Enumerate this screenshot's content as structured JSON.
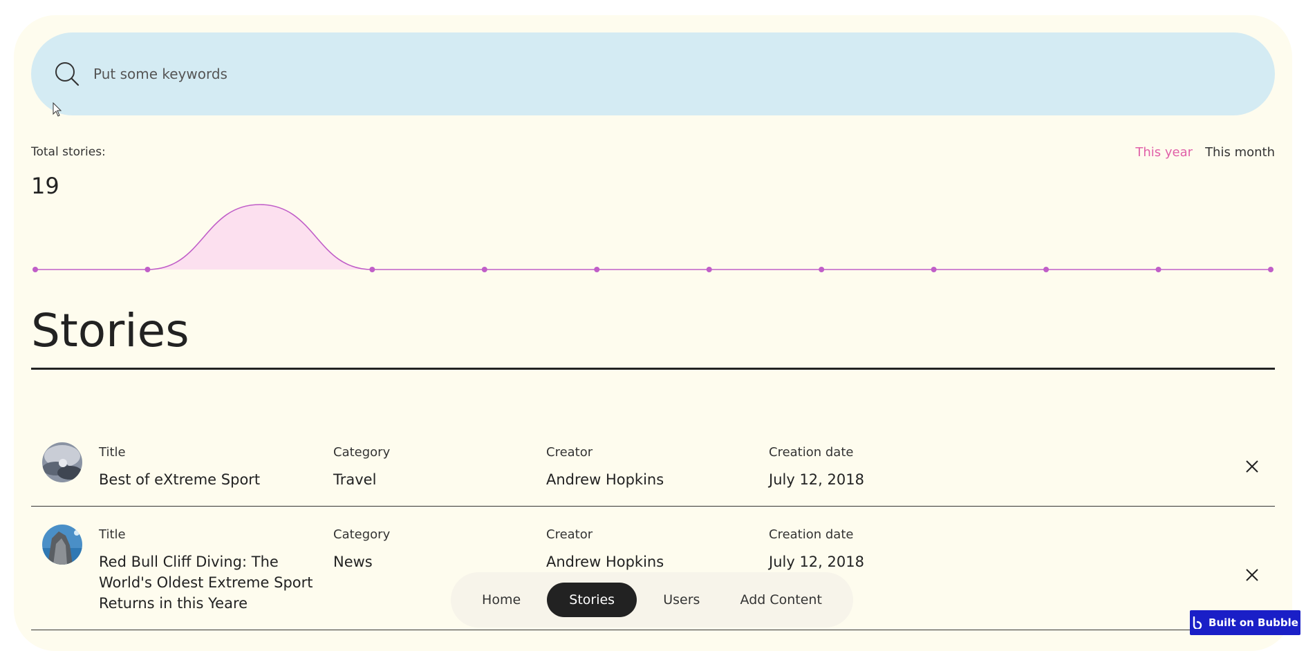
{
  "search": {
    "placeholder": "Put some keywords"
  },
  "stats": {
    "total_label": "Total stories:",
    "total_value": "19",
    "range_options": [
      "This year",
      "This month"
    ],
    "active_range": "This year"
  },
  "chart_data": {
    "type": "area",
    "x": [
      1,
      2,
      3,
      4,
      5,
      6,
      7,
      8,
      9,
      10,
      11,
      12
    ],
    "values": [
      0,
      0,
      1,
      0,
      0,
      0,
      0,
      0,
      0,
      0,
      0,
      0
    ],
    "ylim": [
      0,
      1
    ],
    "grid": false,
    "line_color": "#c05ec8",
    "fill_color": "#fce0ef"
  },
  "page": {
    "heading": "Stories"
  },
  "columns": {
    "title": "Title",
    "category": "Category",
    "creator": "Creator",
    "date": "Creation date"
  },
  "rows": [
    {
      "title": "Best of eXtreme Sport",
      "category": "Travel",
      "creator": "Andrew Hopkins",
      "date": "July 12, 2018"
    },
    {
      "title": "Red Bull Cliff Diving: The World's Oldest Extreme Sport Returns in this Yeare",
      "category": "News",
      "creator": "Andrew Hopkins",
      "date": "July 12, 2018"
    }
  ],
  "nav": {
    "items": [
      "Home",
      "Stories",
      "Users",
      "Add Content"
    ],
    "active": "Stories"
  },
  "badge": {
    "label": "Built on Bubble"
  },
  "colors": {
    "accent": "#e060a8",
    "card_bg": "#fefcee",
    "search_bg": "#d4ebf3",
    "badge_bg": "#1a1fc7"
  }
}
